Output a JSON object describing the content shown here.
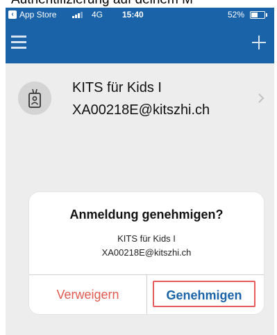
{
  "caption": "Authentifizierung auf deinem M",
  "status_bar": {
    "back_app": "App Store",
    "network": "4G",
    "time": "15:40",
    "battery_pct": "52%",
    "battery_level": 0.52
  },
  "nav": {
    "menu_icon": "hamburger-icon",
    "add_icon": "plus-icon"
  },
  "account": {
    "icon": "id-badge-icon",
    "name": "KITS für Kids I",
    "email": "XA00218E@kitszhi.ch"
  },
  "dialog": {
    "title": "Anmeldung genehmigen?",
    "line1": "KITS für Kids I",
    "line2": "XA00218E@kitszhi.ch",
    "deny_label": "Verweigern",
    "approve_label": "Genehmigen"
  },
  "colors": {
    "brand_blue": "#1a63a9",
    "deny_red": "#e05a50",
    "highlight_red": "#e85a5a"
  }
}
